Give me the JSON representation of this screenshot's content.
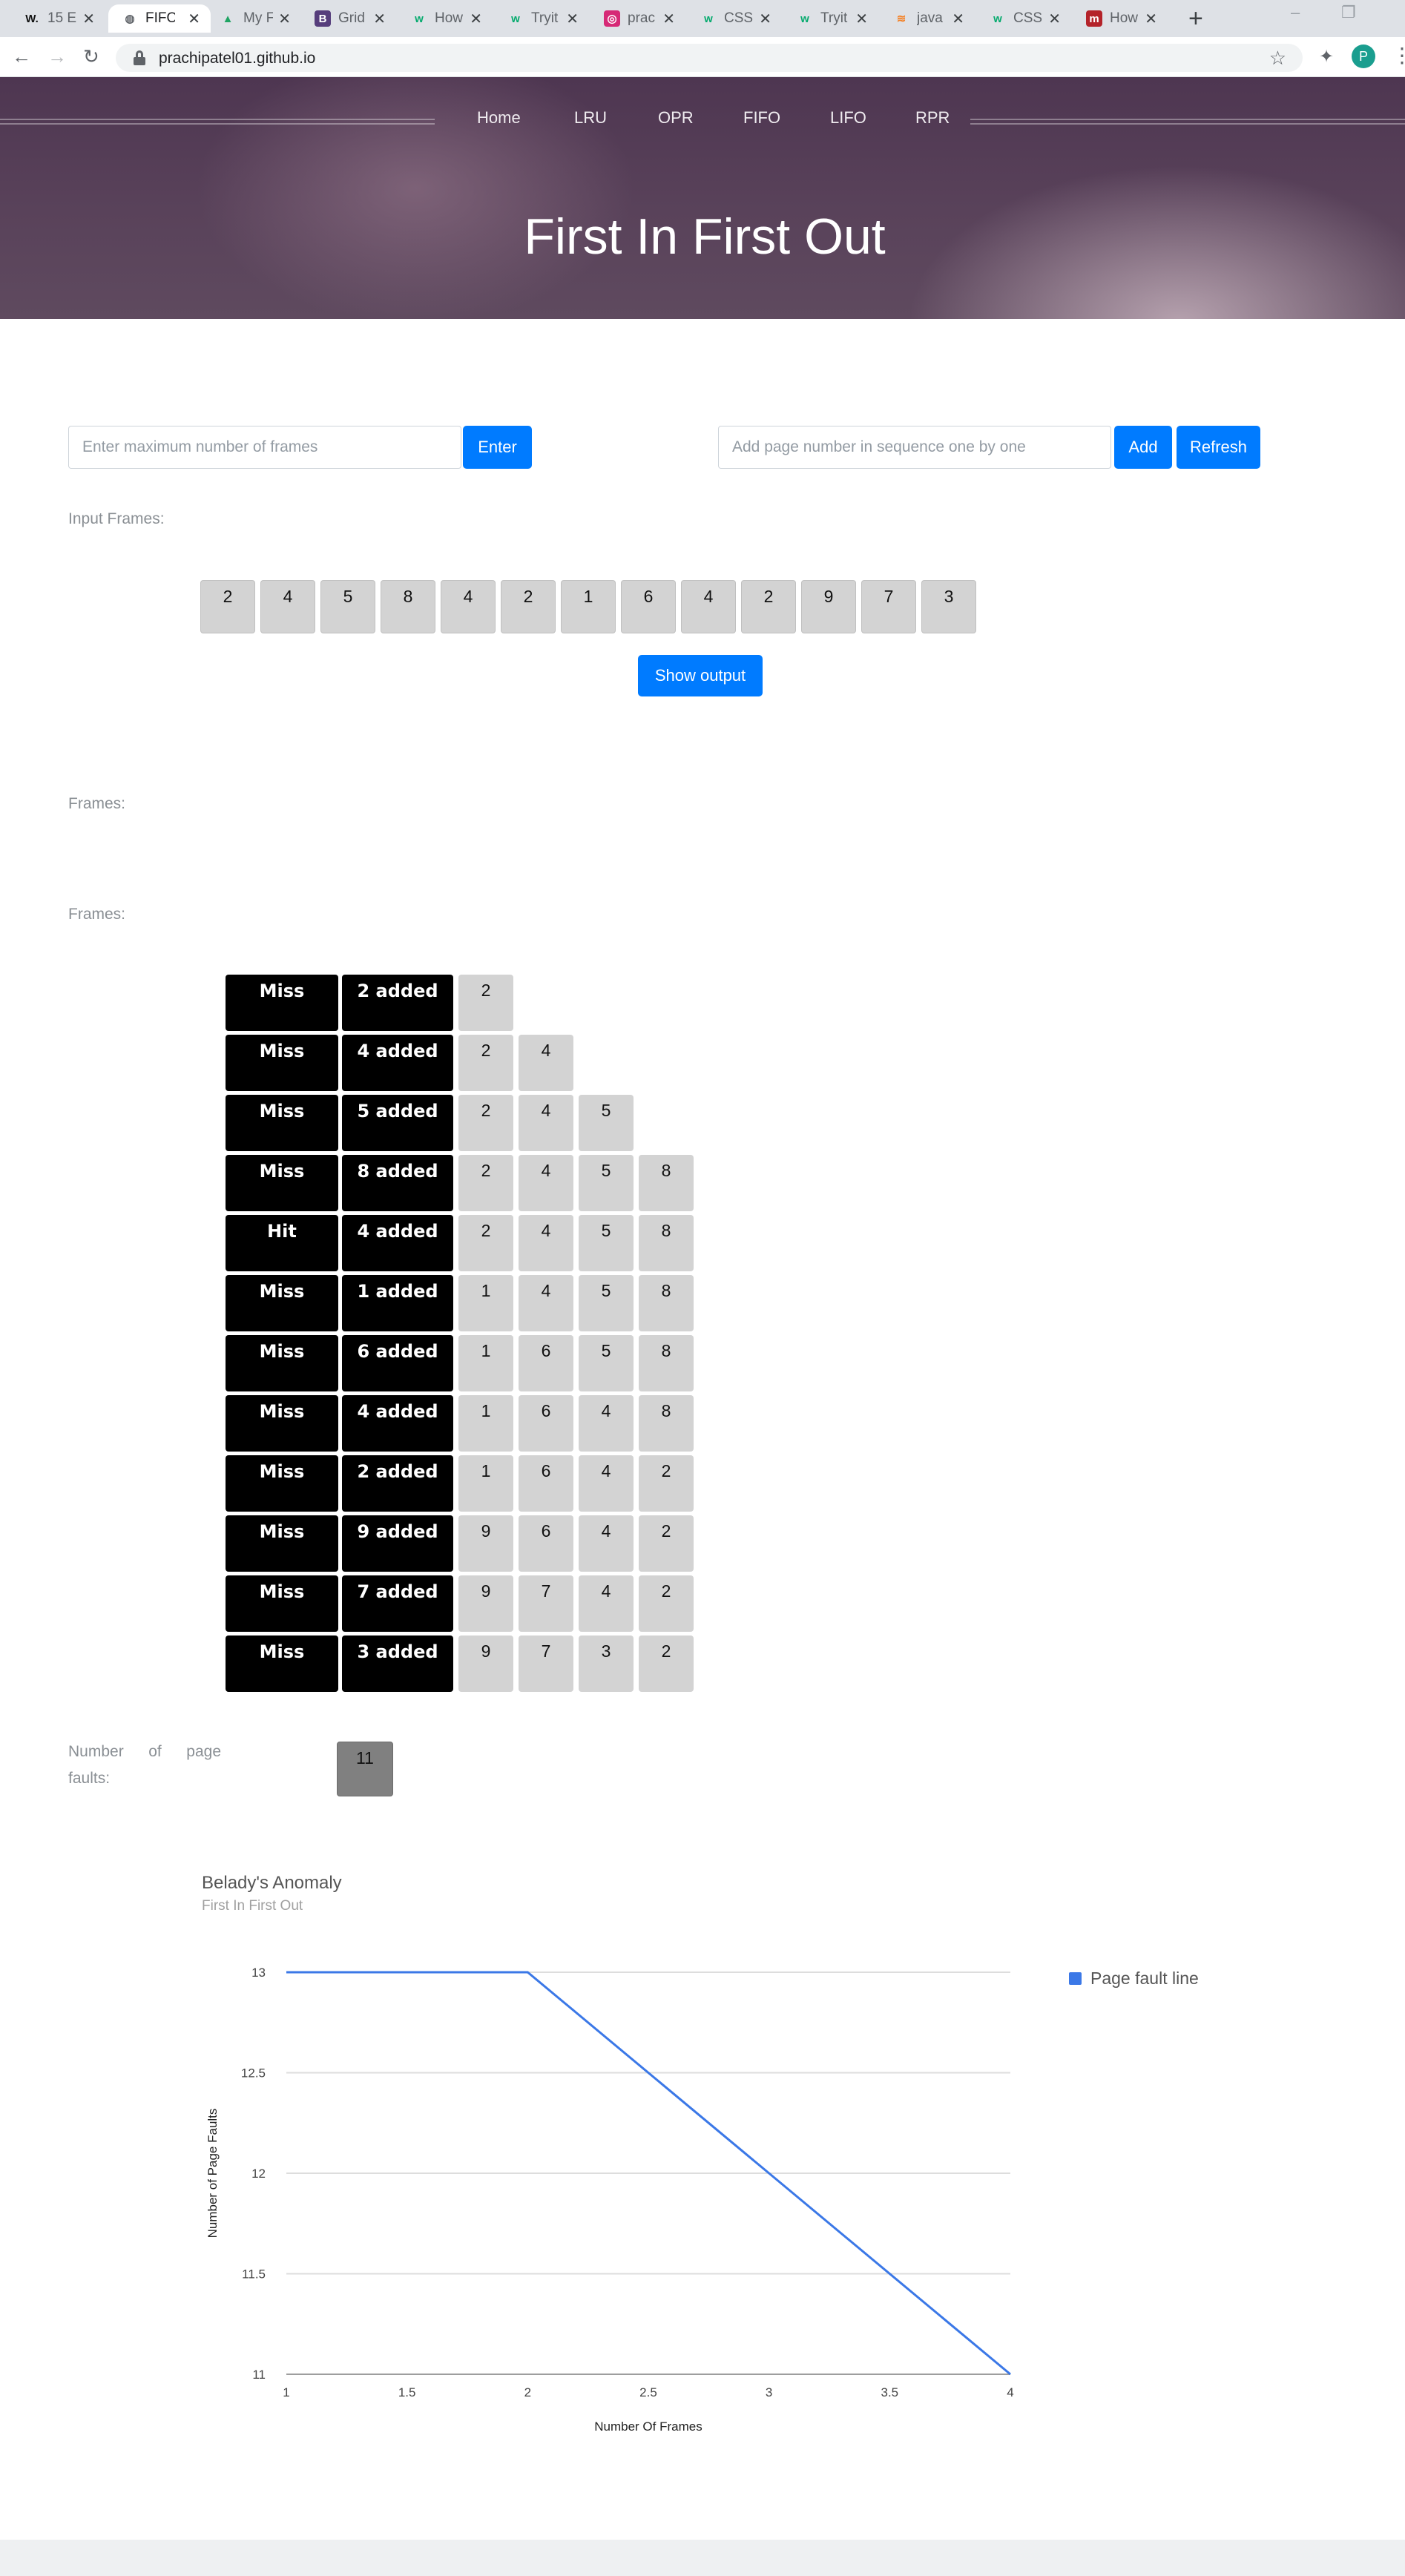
{
  "browser": {
    "tabs": [
      {
        "title": "15 E",
        "fav": "W.",
        "color": "#1a1a1a",
        "active": false
      },
      {
        "title": "FIFO",
        "fav": "globe",
        "color": "#5f6368",
        "active": true
      },
      {
        "title": "My F",
        "fav": "drive",
        "color": "#1fa463",
        "active": false
      },
      {
        "title": "Grid",
        "fav": "B",
        "color": "#563d7c",
        "active": false
      },
      {
        "title": "How",
        "fav": "w3",
        "color": "#04aa6d",
        "active": false
      },
      {
        "title": "Tryit",
        "fav": "w3",
        "color": "#04aa6d",
        "active": false
      },
      {
        "title": "prac",
        "fav": "ig",
        "color": "#d62976",
        "active": false
      },
      {
        "title": "CSS",
        "fav": "w3",
        "color": "#04aa6d",
        "active": false
      },
      {
        "title": "Tryit",
        "fav": "w3",
        "color": "#04aa6d",
        "active": false
      },
      {
        "title": "java",
        "fav": "so",
        "color": "#f48024",
        "active": false
      },
      {
        "title": "CSS",
        "fav": "w3",
        "color": "#04aa6d",
        "active": false
      },
      {
        "title": "How",
        "fav": "m",
        "color": "#b4232a",
        "active": false
      }
    ],
    "url": "prachipatel01.github.io",
    "profile_initial": "P"
  },
  "nav": {
    "home": "Home",
    "lru": "LRU",
    "opr": "OPR",
    "fifo": "FIFO",
    "lifo": "LIFO",
    "rpr": "RPR"
  },
  "hero": {
    "title": "First In First Out"
  },
  "form": {
    "frames_placeholder": "Enter maximum number of frames",
    "enter_label": "Enter",
    "page_placeholder": "Add page number in sequence one by one",
    "add_label": "Add",
    "refresh_label": "Refresh",
    "show_output_label": "Show output"
  },
  "labels": {
    "input_frames": "Input Frames:",
    "frames1": "Frames:",
    "frames2": "Frames:",
    "faults_words": [
      "Number",
      "of",
      "page",
      "faults:"
    ]
  },
  "input_frames": [
    "2",
    "4",
    "5",
    "8",
    "4",
    "2",
    "1",
    "6",
    "4",
    "2",
    "9",
    "7",
    "3"
  ],
  "steps": [
    {
      "status": "Miss",
      "action": "2 added",
      "frames": [
        "2"
      ]
    },
    {
      "status": "Miss",
      "action": "4 added",
      "frames": [
        "2",
        "4"
      ]
    },
    {
      "status": "Miss",
      "action": "5 added",
      "frames": [
        "2",
        "4",
        "5"
      ]
    },
    {
      "status": "Miss",
      "action": "8 added",
      "frames": [
        "2",
        "4",
        "5",
        "8"
      ]
    },
    {
      "status": "Hit",
      "action": "4 added",
      "frames": [
        "2",
        "4",
        "5",
        "8"
      ]
    },
    {
      "status": "Miss",
      "action": "1 added",
      "frames": [
        "1",
        "4",
        "5",
        "8"
      ]
    },
    {
      "status": "Miss",
      "action": "6 added",
      "frames": [
        "1",
        "6",
        "5",
        "8"
      ]
    },
    {
      "status": "Miss",
      "action": "4 added",
      "frames": [
        "1",
        "6",
        "4",
        "8"
      ]
    },
    {
      "status": "Miss",
      "action": "2 added",
      "frames": [
        "1",
        "6",
        "4",
        "2"
      ]
    },
    {
      "status": "Miss",
      "action": "9 added",
      "frames": [
        "9",
        "6",
        "4",
        "2"
      ]
    },
    {
      "status": "Miss",
      "action": "7 added",
      "frames": [
        "9",
        "7",
        "4",
        "2"
      ]
    },
    {
      "status": "Miss",
      "action": "3 added",
      "frames": [
        "9",
        "7",
        "3",
        "2"
      ]
    }
  ],
  "page_faults": "11",
  "chart_data": {
    "type": "line",
    "title": "Belady's Anomaly",
    "subtitle": "First In First Out",
    "xlabel": "Number Of Frames",
    "ylabel": "Number of Page Faults",
    "x": [
      1,
      2,
      3,
      4
    ],
    "series": [
      {
        "name": "Page fault line",
        "values": [
          13,
          13,
          12,
          11
        ],
        "color": "#3b78e7"
      }
    ],
    "xlim": [
      1,
      4
    ],
    "ylim": [
      11,
      13
    ],
    "xticks": [
      "1",
      "1.5",
      "2",
      "2.5",
      "3",
      "3.5",
      "4"
    ],
    "yticks": [
      "11",
      "11.5",
      "12",
      "12.5",
      "13"
    ],
    "grid": true,
    "legend": "right"
  }
}
